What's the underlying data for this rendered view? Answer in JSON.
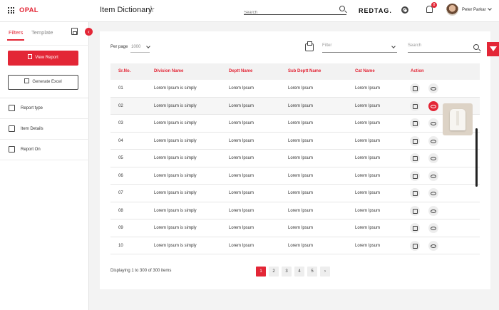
{
  "header": {
    "brand": "OPAL",
    "title": "Item Dictionary",
    "search_placeholder": "Search",
    "store_logo": "REDTAG.",
    "notification_count": "8",
    "user_name": "Peter Parkar"
  },
  "sidebar": {
    "tabs": [
      "Filters",
      "Template"
    ],
    "view_report_label": "View Report",
    "generate_excel_label": "Generate Excel",
    "items": [
      {
        "label": "Report type",
        "icon": "report-type-icon"
      },
      {
        "label": "Item Details",
        "icon": "item-details-icon"
      },
      {
        "label": "Report On",
        "icon": "clipboard-icon"
      }
    ]
  },
  "toolbar": {
    "per_page_label": "Per page",
    "per_page_value": "1000",
    "filter_placeholder": "Filter",
    "search_placeholder": "Search"
  },
  "table": {
    "columns": [
      "Sr.No.",
      "Division Name",
      "Deptt Name",
      "Sub Deptt Name",
      "Cat Name",
      "Action"
    ],
    "rows": [
      [
        "01",
        "Lorem Ipsum is simply",
        "Lorem Ipsum",
        "Lorem Ipsum",
        "Lorem Ipsum"
      ],
      [
        "02",
        "Lorem Ipsum is simply",
        "Lorem Ipsum",
        "Lorem Ipsum",
        "Lorem Ipsum"
      ],
      [
        "03",
        "Lorem Ipsum is simply",
        "Lorem Ipsum",
        "Lorem Ipsum",
        "Lorem Ipsum"
      ],
      [
        "04",
        "Lorem Ipsum is simply",
        "Lorem Ipsum",
        "Lorem Ipsum",
        "Lorem Ipsum"
      ],
      [
        "05",
        "Lorem Ipsum is simply",
        "Lorem Ipsum",
        "Lorem Ipsum",
        "Lorem Ipsum"
      ],
      [
        "06",
        "Lorem Ipsum is simply",
        "Lorem Ipsum",
        "Lorem Ipsum",
        "Lorem Ipsum"
      ],
      [
        "07",
        "Lorem Ipsum is simply",
        "Lorem Ipsum",
        "Lorem Ipsum",
        "Lorem Ipsum"
      ],
      [
        "08",
        "Lorem Ipsum is simply",
        "Lorem Ipsum",
        "Lorem Ipsum",
        "Lorem Ipsum"
      ],
      [
        "09",
        "Lorem Ipsum is simply",
        "Lorem Ipsum",
        "Lorem Ipsum",
        "Lorem Ipsum"
      ],
      [
        "10",
        "Lorem Ipsum is simply",
        "Lorem Ipsum",
        "Lorem Ipsum",
        "Lorem Ipsum"
      ]
    ],
    "active_view_row": 2
  },
  "footer": {
    "display_text": "Displaying 1 to 300 of 300 items",
    "pages": [
      "1",
      "2",
      "3",
      "4",
      "5",
      "›"
    ],
    "active_page": "1"
  },
  "colors": {
    "accent": "#e32636"
  }
}
